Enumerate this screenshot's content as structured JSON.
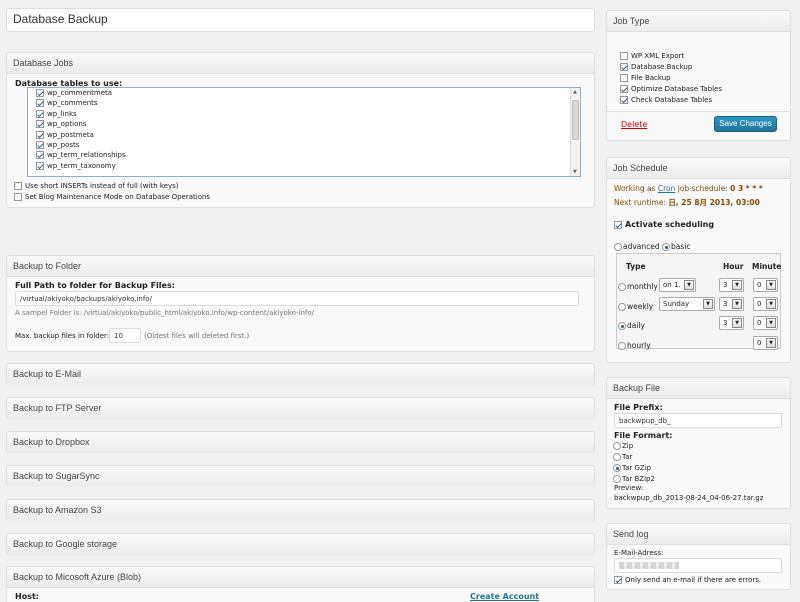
{
  "page_title": "Database Backup",
  "db_jobs": {
    "header": "Database Jobs",
    "tables_label": "Database tables to use:",
    "tables": [
      {
        "name": "wp_commentmeta",
        "checked": true
      },
      {
        "name": "wp_comments",
        "checked": true
      },
      {
        "name": "wp_links",
        "checked": true
      },
      {
        "name": "wp_options",
        "checked": true
      },
      {
        "name": "wp_postmeta",
        "checked": true
      },
      {
        "name": "wp_posts",
        "checked": true
      },
      {
        "name": "wp_term_relationships",
        "checked": true
      },
      {
        "name": "wp_term_taxonomy",
        "checked": true
      }
    ],
    "short_inserts": "Use short INSERTs instead of full (with keys)",
    "maintenance_mode": "Set Blog Maintenance Mode on Database Operations"
  },
  "backup_folder": {
    "header": "Backup to Folder",
    "path_label": "Full Path to folder for Backup Files:",
    "path_value": "/virtual/akiyoko/backups/akiyoko.info/",
    "sample": "A sampel Folder is: /virtual/akiyoko/public_html/akiyoko.info/wp-content/akiyoko-info/",
    "max_label": "Max. backup files in folder:",
    "max_value": "10",
    "max_note": "(Oldest files will deleted first.)"
  },
  "collapsed_sections": [
    "Backup to E-Mail",
    "Backup to FTP Server",
    "Backup to Dropbox",
    "Backup to SugarSync",
    "Backup to Amazon S3",
    "Backup to Google storage"
  ],
  "azure": {
    "header": "Backup to Micosoft Azure (Blob)",
    "host_label": "Host:",
    "create_account": "Create Account"
  },
  "job_type": {
    "header": "Job Type",
    "items": [
      {
        "label": "WP XML Export",
        "checked": false
      },
      {
        "label": "Database Backup",
        "checked": true
      },
      {
        "label": "File Backup",
        "checked": false
      },
      {
        "label": "Optimize Database Tables",
        "checked": true
      },
      {
        "label": "Check Database Tables",
        "checked": true
      }
    ],
    "delete": "Delete",
    "save": "Save Changes"
  },
  "job_schedule": {
    "header": "Job Schedule",
    "working_prefix": "Working as",
    "cron_link": "Cron",
    "working_suffix": "job schedule:",
    "schedule_value": "0 3 * * *",
    "next_label": "Next runtime:",
    "next_value": "日, 25 8月 2013, 03:00",
    "activate": "Activate scheduling",
    "mode_advanced": "advanced",
    "mode_basic": "basic",
    "col_type": "Type",
    "col_hour": "Hour",
    "col_minute": "Minute",
    "rows": [
      {
        "label": "monthly",
        "selected": false,
        "day": "on 1.",
        "hour": "3",
        "minute": "0"
      },
      {
        "label": "weekly",
        "selected": false,
        "day": "Sunday",
        "hour": "3",
        "minute": "0"
      },
      {
        "label": "daily",
        "selected": true,
        "hour": "3",
        "minute": "0"
      },
      {
        "label": "hourly",
        "selected": false,
        "minute": "0"
      }
    ]
  },
  "backup_file": {
    "header": "Backup File",
    "prefix_label": "File Prefix:",
    "prefix_value": "backwpup_db_",
    "format_label": "File Formart:",
    "formats": [
      {
        "label": "Zip",
        "selected": false
      },
      {
        "label": "Tar",
        "selected": false
      },
      {
        "label": "Tar GZip",
        "selected": true
      },
      {
        "label": "Tar BZip2",
        "selected": false
      }
    ],
    "preview_label": "Preview:",
    "preview_value": "backwpup_db_2013-08-24_04-06-27.tar.gz"
  },
  "send_log": {
    "header": "Send log",
    "email_label": "E-Mail-Adress:",
    "email_value": "",
    "only_errors": "Only send an e-mail if there are errors.",
    "only_errors_checked": true
  }
}
